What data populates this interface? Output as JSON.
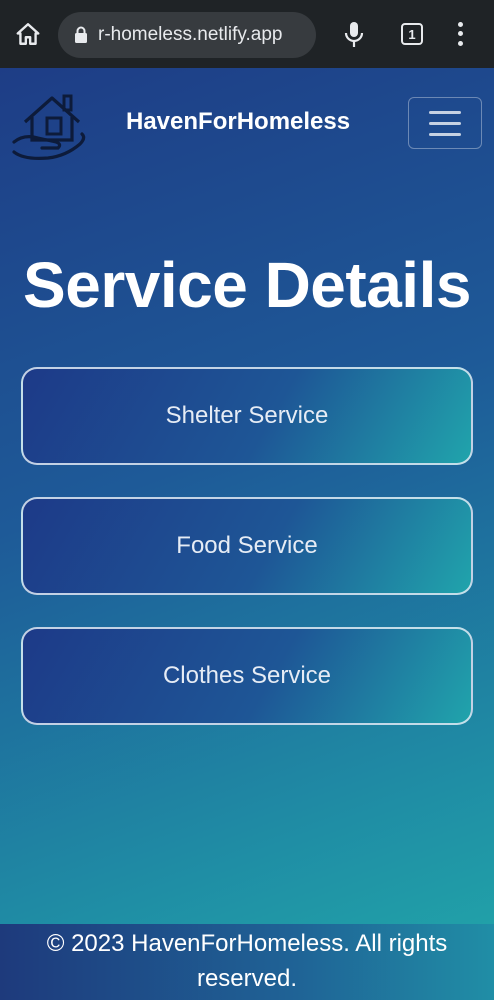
{
  "browser": {
    "url": "r-homeless.netlify.app",
    "tab_count": "1"
  },
  "navbar": {
    "brand": "HavenForHomeless"
  },
  "main": {
    "title": "Service Details",
    "services": [
      "Shelter Service",
      "Food Service",
      "Clothes Service"
    ]
  },
  "footer": {
    "text": "© 2023 HavenForHomeless. All rights reserved."
  },
  "icons": [
    "home-icon",
    "lock-icon",
    "microphone-icon",
    "tabs-icon",
    "more-vert-icon",
    "house-in-hand-logo",
    "hamburger-menu-icon"
  ],
  "colors": {
    "browser_bar": "#1f2326",
    "url_pill": "#373b3f",
    "gradient_start": "#1e3d86",
    "gradient_end": "#21a0a8",
    "text": "#ffffff"
  }
}
